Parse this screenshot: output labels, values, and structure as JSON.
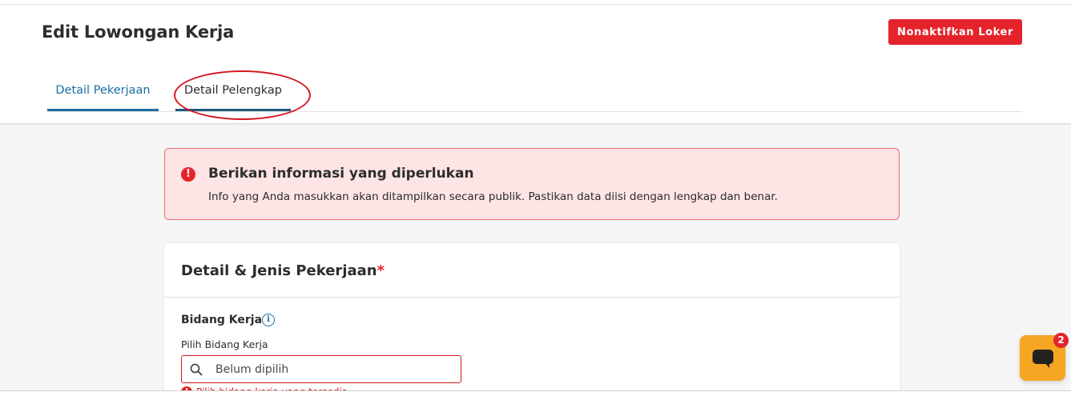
{
  "header": {
    "title": "Edit Lowongan Kerja",
    "deactivate_label": "Nonaktifkan Loker"
  },
  "tabs": [
    {
      "label": "Detail Pekerjaan",
      "active": true
    },
    {
      "label": "Detail Pelengkap",
      "active": false
    }
  ],
  "alert": {
    "icon": "!",
    "title": "Berikan informasi yang diperlukan",
    "description": "Info yang Anda masukkan akan ditampilkan secara publik. Pastikan data diisi dengan lengkap dan benar."
  },
  "section": {
    "title": "Detail & Jenis Pekerjaan",
    "required_mark": "*",
    "field": {
      "label": "Bidang Kerja",
      "info_icon": "i",
      "sublabel": "Pilih Bidang Kerja",
      "placeholder": "Belum dipilih",
      "error_icon": "!",
      "error": "Pilih bidang kerja yang tersedia"
    }
  },
  "chat": {
    "badge_count": "2"
  },
  "colors": {
    "primary_red": "#e5232b",
    "tab_blue": "#1a6fa3",
    "alert_bg": "#fde4e5",
    "chat_orange": "#f5a623"
  }
}
